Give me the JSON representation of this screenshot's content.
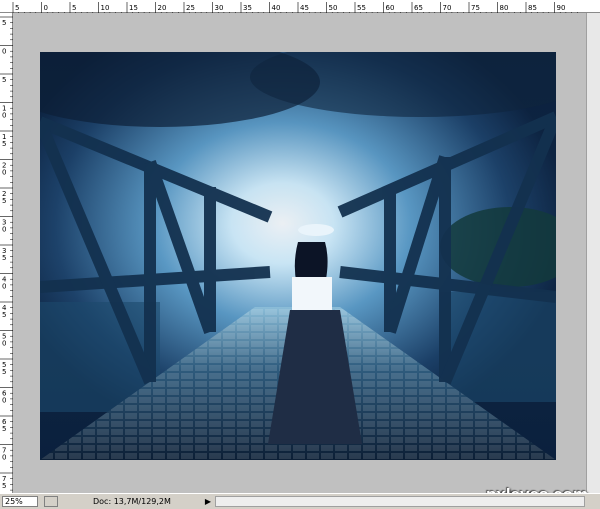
{
  "ruler_top_labels": [
    "5",
    "0",
    "5",
    "10",
    "15",
    "20",
    "25",
    "30",
    "35",
    "40",
    "45",
    "50",
    "55",
    "60",
    "65",
    "70",
    "75",
    "80",
    "85",
    "90"
  ],
  "ruler_left_labels": [
    "5",
    "0",
    "5",
    "10",
    "15",
    "20",
    "25",
    "30",
    "35",
    "40",
    "45",
    "50",
    "55",
    "60",
    "65",
    "70",
    "75"
  ],
  "status": {
    "zoom": "25%",
    "doc": "Doc: 13,7M/129,2M",
    "arrow": "▶"
  },
  "watermark": "pxleyes.com",
  "colors": {
    "ui_gray": "#c0c0c0",
    "sky_glow": "#d8f2ff",
    "bridge_dark": "#102b48"
  }
}
